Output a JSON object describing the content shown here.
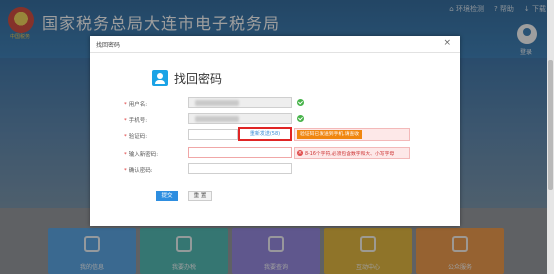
{
  "header": {
    "site_title": "国家税务总局大连市电子税务局",
    "emblem_text": "中国税务",
    "links": [
      "环境检测",
      "帮助",
      "下载"
    ],
    "login_label": "登录"
  },
  "tiles": [
    {
      "label": "我的信息",
      "color": "#4a9fe6"
    },
    {
      "label": "我要办税",
      "color": "#41b6b0"
    },
    {
      "label": "我要查询",
      "color": "#8d7fe0"
    },
    {
      "label": "互动中心",
      "color": "#e3b32b"
    },
    {
      "label": "公众服务",
      "color": "#f0923a"
    }
  ],
  "modal": {
    "title": "找回密码",
    "close_glyph": "×",
    "heading": "找回密码",
    "fields": {
      "username_label": "用户名:",
      "phone_label": "手机号:",
      "code_label": "验证码:",
      "new_pw_label": "输入新密码:",
      "confirm_pw_label": "确认密码:"
    },
    "send_code_button": "重新发送(58)",
    "code_tip": "验证码已发送到手机,请查收",
    "password_error": "8-16个字符,必须包含数字和大、小写字母",
    "submit_label": "提交",
    "reset_label": "重 置"
  }
}
